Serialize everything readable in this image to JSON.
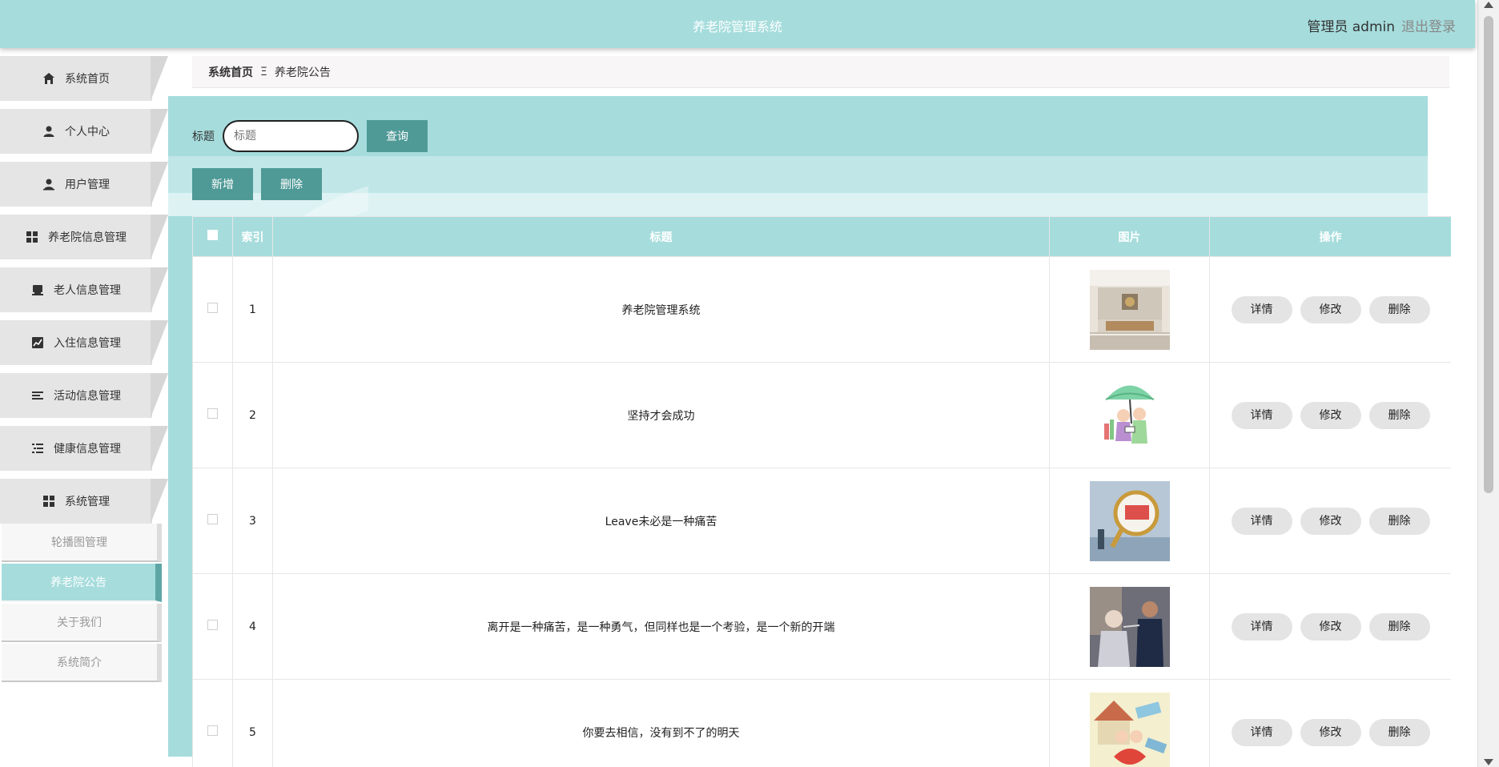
{
  "header": {
    "title": "养老院管理系统",
    "user": "管理员 admin",
    "logout": "退出登录"
  },
  "sidebar": {
    "items": [
      {
        "label": "系统首页",
        "icon": "home-icon"
      },
      {
        "label": "个人中心",
        "icon": "user-icon"
      },
      {
        "label": "用户管理",
        "icon": "user-manage-icon"
      },
      {
        "label": "养老院信息管理",
        "icon": "grid-icon"
      },
      {
        "label": "老人信息管理",
        "icon": "shop-icon"
      },
      {
        "label": "入住信息管理",
        "icon": "chart-icon"
      },
      {
        "label": "活动信息管理",
        "icon": "list-icon"
      },
      {
        "label": "健康信息管理",
        "icon": "indent-list-icon"
      },
      {
        "label": "系统管理",
        "icon": "grid-icon"
      }
    ],
    "submenu": [
      {
        "label": "轮播图管理",
        "active": false
      },
      {
        "label": "养老院公告",
        "active": true
      },
      {
        "label": "关于我们",
        "active": false
      },
      {
        "label": "系统简介",
        "active": false
      }
    ]
  },
  "breadcrumb": {
    "home": "系统首页",
    "separator": "Ξ",
    "current": "养老院公告"
  },
  "search": {
    "label": "标题",
    "placeholder": "标题",
    "query_button": "查询"
  },
  "actions": {
    "add_button": "新增",
    "delete_button": "删除"
  },
  "table": {
    "headers": {
      "index": "索引",
      "title": "标题",
      "image": "图片",
      "operation": "操作"
    },
    "rows": [
      {
        "index": "1",
        "title": "养老院管理系统",
        "image": "lobby-photo"
      },
      {
        "index": "2",
        "title": "坚持才会成功",
        "image": "elderly-couple-umbrella-illustration"
      },
      {
        "index": "3",
        "title": "Leave未必是一种痛苦",
        "image": "pension-magnifier-photo"
      },
      {
        "index": "4",
        "title": "离开是一种痛苦，是一种勇气，但同样也是一个考验，是一个新的开端",
        "image": "caregiver-feeding-photo"
      },
      {
        "index": "5",
        "title": "你要去相信，没有到不了的明天",
        "image": "elderly-house-cartoon"
      }
    ],
    "row_buttons": {
      "detail": "详情",
      "edit": "修改",
      "delete": "删除"
    }
  },
  "colors": {
    "theme": "#a6dcdc",
    "button": "#4f9a97",
    "active_accent": "#5ea6a6"
  }
}
